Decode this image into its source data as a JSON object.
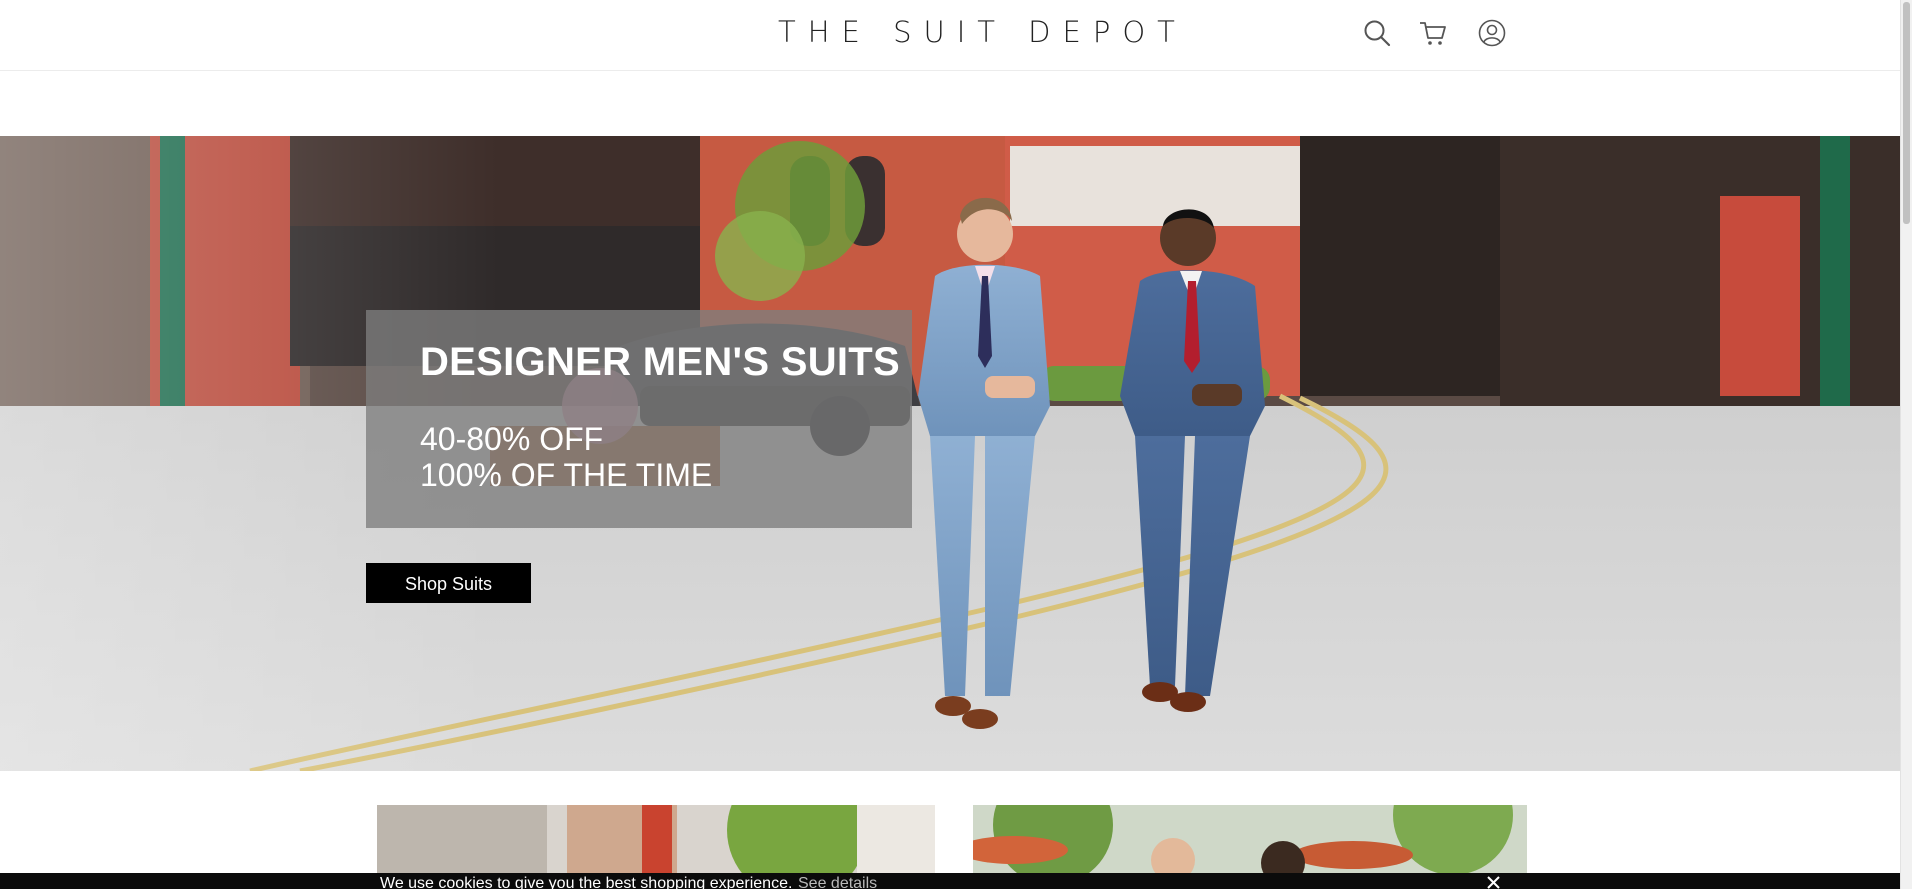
{
  "header": {
    "logo_text": "THE SUIT DEPOT",
    "icons": [
      "search-icon",
      "cart-icon",
      "account-icon"
    ]
  },
  "hero": {
    "title": "DESIGNER MEN'S SUITS",
    "subtitle_line1": "40-80% OFF",
    "subtitle_line2": "100% OF THE TIME",
    "cta_label": "Shop Suits"
  },
  "cookie_bar": {
    "message": "We use cookies to give you the best shopping experience.",
    "link_label": "See details",
    "close_icon": "close-icon"
  },
  "colors": {
    "header_text": "#222222",
    "promo_box": "#7d7d7d",
    "button_bg": "#000000",
    "cookie_bg": "#0b0b0b"
  }
}
